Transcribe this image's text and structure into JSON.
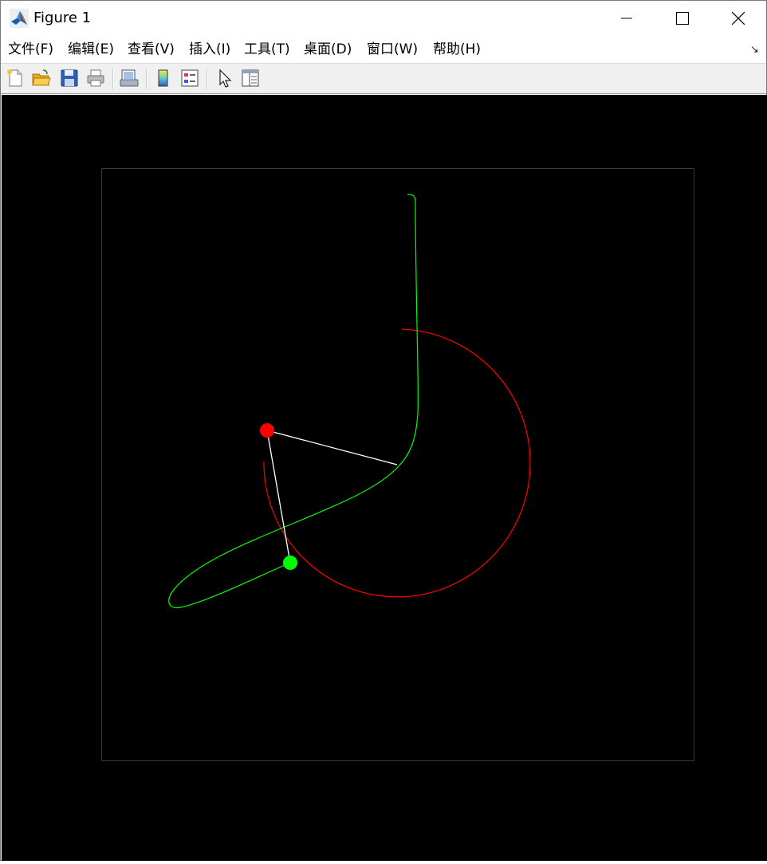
{
  "window": {
    "title": "Figure 1"
  },
  "menu": {
    "items": [
      {
        "label": "文件(F)"
      },
      {
        "label": "编辑(E)"
      },
      {
        "label": "查看(V)"
      },
      {
        "label": "插入(I)"
      },
      {
        "label": "工具(T)"
      },
      {
        "label": "桌面(D)"
      },
      {
        "label": "窗口(W)"
      },
      {
        "label": "帮助(H)"
      }
    ]
  },
  "toolbar": {
    "buttons": [
      "new-figure-icon",
      "open-file-icon",
      "save-icon",
      "print-icon",
      "print-preview-icon",
      "insert-colorbar-icon",
      "insert-legend-icon",
      "edit-plot-icon",
      "property-editor-icon"
    ]
  },
  "figure": {
    "background": "#000000",
    "axes_box_color": "#3a3a3a",
    "trail_color": "#00ff00",
    "arc_color": "#ff0000",
    "rod_color": "#ffffff",
    "bob1_color": "#ff0000",
    "bob2_color": "#00ff00"
  }
}
